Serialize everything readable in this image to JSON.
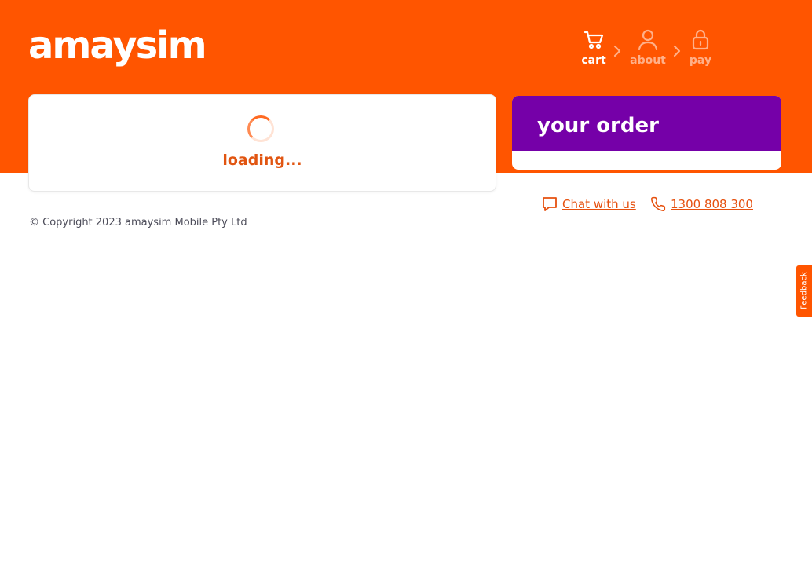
{
  "brand": {
    "logo_text": "amaysim",
    "primary_color": "#ff5500",
    "secondary_color": "#7500a8"
  },
  "steps": [
    {
      "label": "cart",
      "icon": "cart-icon",
      "state": "active"
    },
    {
      "label": "about",
      "icon": "user-icon",
      "state": "inactive"
    },
    {
      "label": "pay",
      "icon": "lock-icon",
      "state": "inactive"
    }
  ],
  "loading": {
    "text": "loading..."
  },
  "order": {
    "title": "your order"
  },
  "contact": {
    "chat_label": "Chat with us",
    "phone_label": "1300 808 300"
  },
  "footer": {
    "copyright": "© Copyright 2023 amaysim Mobile Pty Ltd"
  },
  "feedback": {
    "label": "Feedback"
  }
}
